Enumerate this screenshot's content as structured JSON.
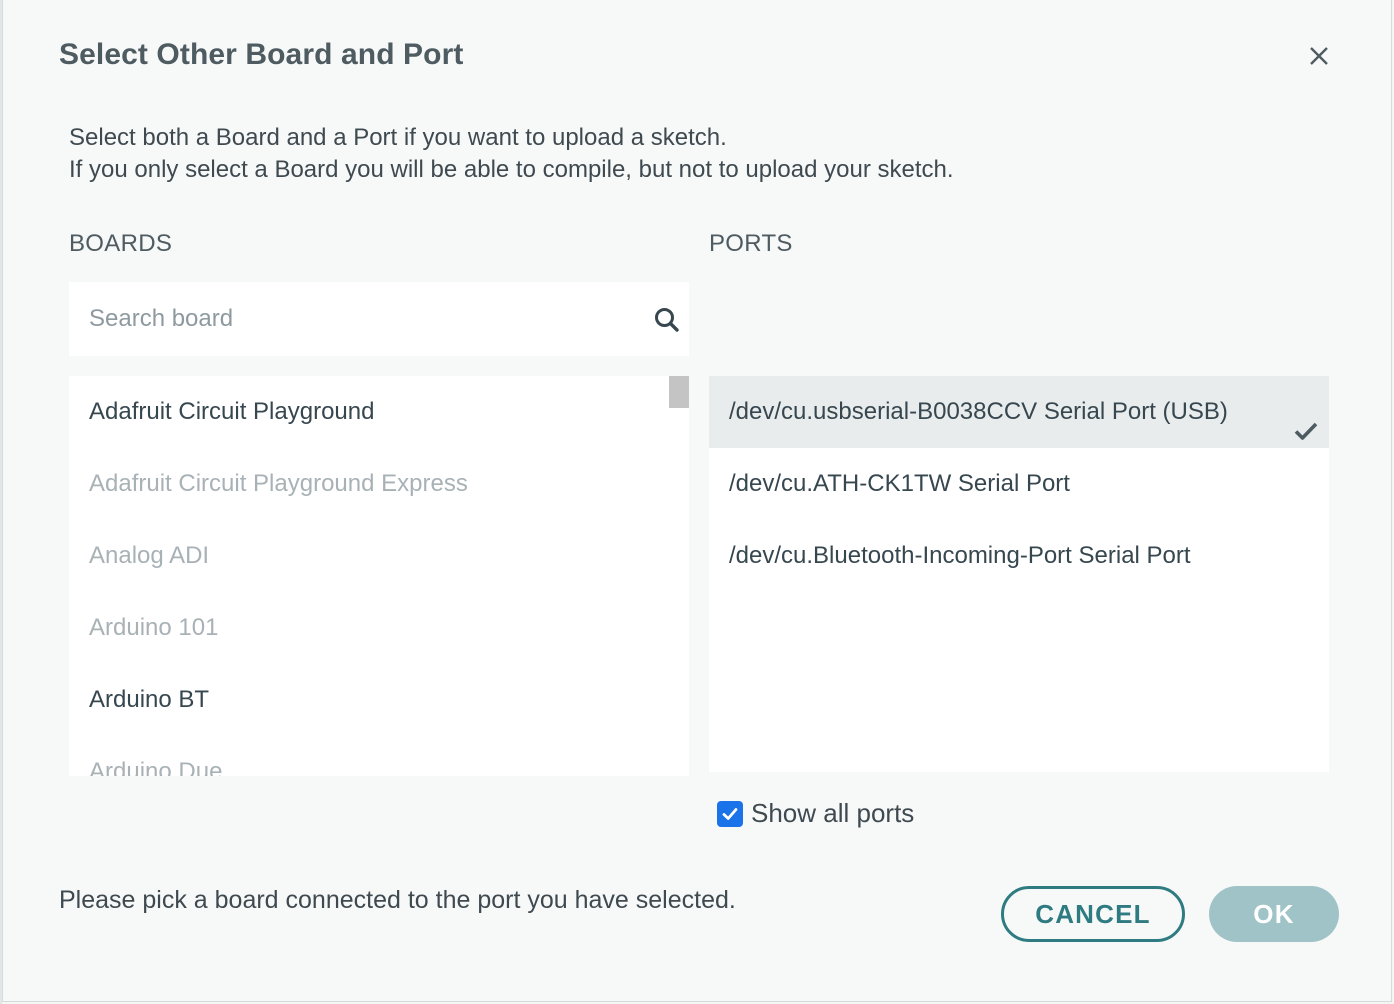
{
  "dialog": {
    "title": "Select Other Board and Port",
    "intro_line1": "Select both a Board and a Port if you want to upload a sketch.",
    "intro_line2": "If you only select a Board you will be able to compile, but not to upload your sketch.",
    "footer_message": "Please pick a board connected to the port you have selected."
  },
  "boards": {
    "label": "BOARDS",
    "search_placeholder": "Search board",
    "items": [
      {
        "label": "Adafruit Circuit Playground",
        "enabled": true
      },
      {
        "label": "Adafruit Circuit Playground Express",
        "enabled": false
      },
      {
        "label": "Analog ADI",
        "enabled": false
      },
      {
        "label": "Arduino 101",
        "enabled": false
      },
      {
        "label": "Arduino BT",
        "enabled": true
      },
      {
        "label": "Arduino Due",
        "enabled": false
      }
    ]
  },
  "ports": {
    "label": "PORTS",
    "items": [
      {
        "label": "/dev/cu.usbserial-B0038CCV Serial Port (USB)",
        "selected": true
      },
      {
        "label": "/dev/cu.ATH-CK1TW Serial Port",
        "selected": false
      },
      {
        "label": "/dev/cu.Bluetooth-Incoming-Port Serial Port",
        "selected": false
      }
    ],
    "show_all_label": "Show all ports",
    "show_all_checked": true
  },
  "buttons": {
    "cancel": "CANCEL",
    "ok": "OK"
  },
  "colors": {
    "accent": "#2f7b82",
    "ok_disabled": "#9fc3c6",
    "checkbox": "#1a73e8"
  }
}
